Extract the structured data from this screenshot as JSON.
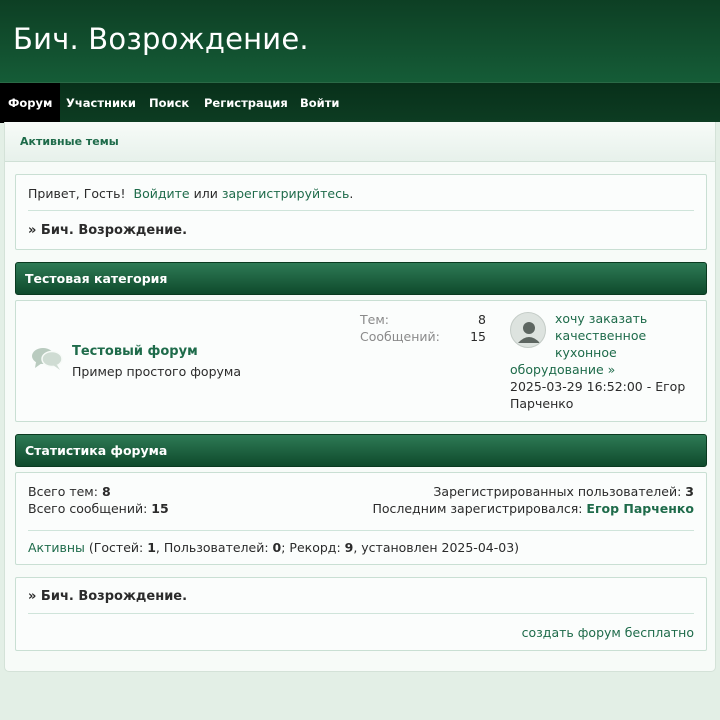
{
  "header": {
    "site_title": "Бич. Возрождение."
  },
  "nav": {
    "items": [
      {
        "label": "Форум",
        "active": true
      },
      {
        "label": "Участники"
      },
      {
        "label": "Поиск"
      },
      {
        "label": "Регистрация"
      },
      {
        "label": "Войти"
      }
    ]
  },
  "active_topics": {
    "label": "Активные темы"
  },
  "greeting": {
    "hello": "Привет, Гость!",
    "login_link": "Войдите",
    "or": "или",
    "register_link": "зарегистрируйтесь",
    "period": ".",
    "breadcrumb": "» Бич. Возрождение."
  },
  "category": {
    "title": "Тестовая категория",
    "forum": {
      "name": "Тестовый форум",
      "description": "Пример простого форума",
      "topics_label": "Тем:",
      "topics": "8",
      "posts_label": "Сообщений:",
      "posts": "15",
      "last_post": {
        "title_lines": [
          "хочу заказать",
          "качественное",
          "кухонное"
        ],
        "title_last": "оборудование",
        "arrow": "»",
        "datetime_author": "2025-03-29 16:52:00 - Егор",
        "author_rest": "Парченко"
      }
    }
  },
  "stats": {
    "title": "Статистика форума",
    "total_topics_label": "Всего тем:",
    "total_topics": "8",
    "total_posts_label": "Всего сообщений:",
    "total_posts": "15",
    "registered_label": "Зарегистрированных пользователей:",
    "registered": "3",
    "last_registered_label": "Последним зарегистрировался:",
    "last_registered": "Егор Парченко",
    "online_link": "Активны",
    "online_open": " (Гостей: ",
    "guests": "1",
    "users_label": ", Пользователей: ",
    "users": "0",
    "record_label": "; Рекорд: ",
    "record": "9",
    "record_date": ", установлен 2025-04-03)"
  },
  "footer": {
    "breadcrumb": "» Бич. Возрождение.",
    "create_link": "создать форум бесплатно"
  },
  "colors": {
    "header_bg": "#155c37",
    "nav_bg": "#08301a",
    "accent_link": "#1e6b4a",
    "category_bar": "#2e7a55",
    "page_bg": "#e3efe6"
  }
}
